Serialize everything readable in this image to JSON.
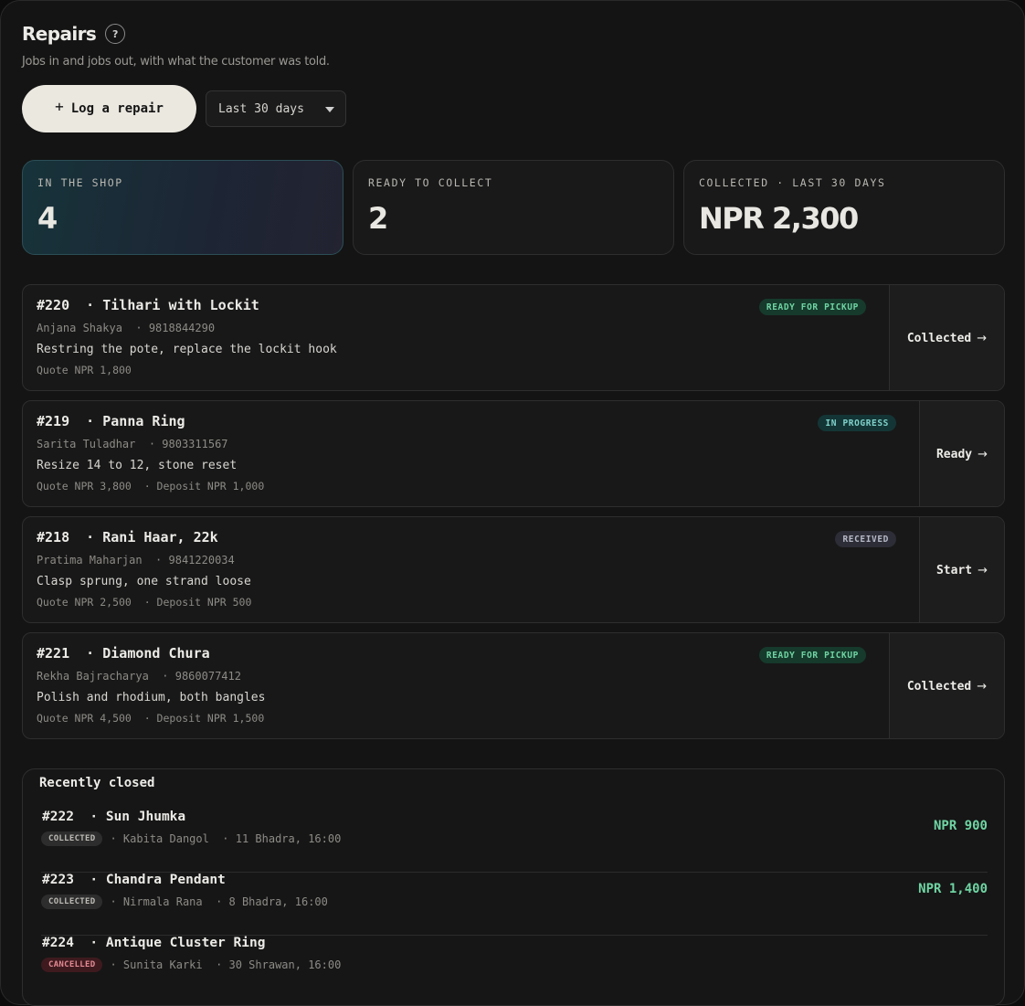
{
  "header": {
    "title": "Repairs",
    "help_icon": "?",
    "subtitle": "Jobs in and jobs out, with what the customer was told."
  },
  "toolbar": {
    "log_plus": "+",
    "log_label": "Log a repair",
    "range_value": "Last 30 days"
  },
  "stats": [
    {
      "label": "IN THE SHOP",
      "value": "4"
    },
    {
      "label": "READY TO COLLECT",
      "value": "2"
    },
    {
      "label": "COLLECTED · LAST 30 DAYS",
      "value": "NPR 2,300"
    }
  ],
  "jobs": [
    {
      "title": "#220  · Tilhari with Lockit",
      "customer": "Anjana Shakya  · 9818844290",
      "description": "Restring the pote, replace the lockit hook",
      "money": "Quote NPR 1,800",
      "status": "READY FOR PICKUP",
      "action": "Collected"
    },
    {
      "title": "#219  · Panna Ring",
      "customer": "Sarita Tuladhar  · 9803311567",
      "description": "Resize 14 to 12, stone reset",
      "money": "Quote NPR 3,800  · Deposit NPR 1,000",
      "status": "IN PROGRESS",
      "action": "Ready"
    },
    {
      "title": "#218  · Rani Haar, 22k",
      "customer": "Pratima Maharjan  · 9841220034",
      "description": "Clasp sprung, one strand loose",
      "money": "Quote NPR 2,500  · Deposit NPR 500",
      "status": "RECEIVED",
      "action": "Start"
    },
    {
      "title": "#221  · Diamond Chura",
      "customer": "Rekha Bajracharya  · 9860077412",
      "description": "Polish and rhodium, both bangles",
      "money": "Quote NPR 4,500  · Deposit NPR 1,500",
      "status": "READY FOR PICKUP",
      "action": "Collected"
    }
  ],
  "closed": {
    "heading": "Recently closed",
    "items": [
      {
        "title": "#222  · Sun Jhumka",
        "status": "COLLECTED",
        "meta": "· Kabita Dangol  · 11 Bhadra, 16:00",
        "amount": "NPR 900"
      },
      {
        "title": "#223  · Chandra Pendant",
        "status": "COLLECTED",
        "meta": "· Nirmala Rana  · 8 Bhadra, 16:00",
        "amount": "NPR 1,400"
      },
      {
        "title": "#224  · Antique Cluster Ring",
        "status": "CANCELLED",
        "meta": "· Sunita Karki  · 30 Shrawan, 16:00",
        "amount": ""
      }
    ]
  },
  "icons": {
    "arrow": "→",
    "caret": "chevron-down-icon"
  }
}
